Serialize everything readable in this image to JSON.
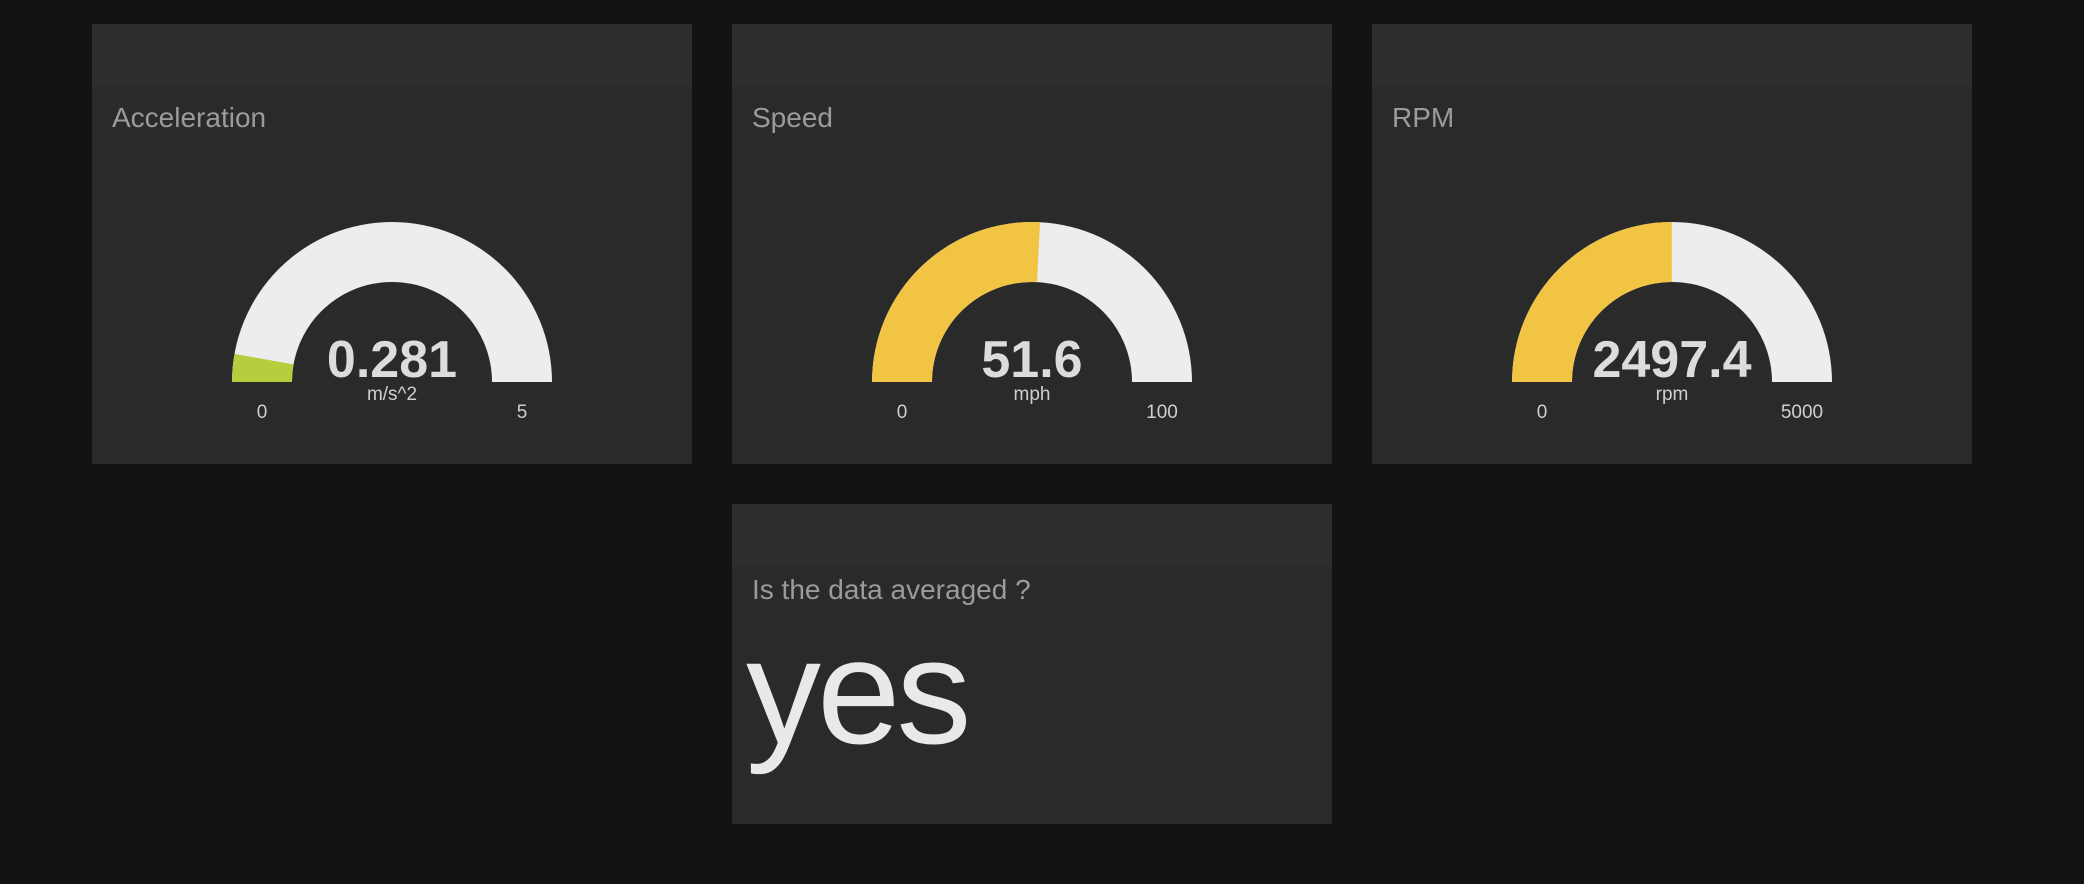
{
  "panes": [
    {
      "title": "Acceleration",
      "value": 0.281,
      "value_text": "0.281",
      "unit": "m/s^2",
      "min": 0,
      "max": 5,
      "min_text": "0",
      "max_text": "5",
      "fill_color": "#b8cd3e"
    },
    {
      "title": "Speed",
      "value": 51.6,
      "value_text": "51.6",
      "unit": "mph",
      "min": 0,
      "max": 100,
      "min_text": "0",
      "max_text": "100",
      "fill_color": "#f1c444"
    },
    {
      "title": "RPM",
      "value": 2497.4,
      "value_text": "2497.4",
      "unit": "rpm",
      "min": 0,
      "max": 5000,
      "min_text": "0",
      "max_text": "5000",
      "fill_color": "#f1c444"
    }
  ],
  "text_pane": {
    "title": "Is the data averaged ?",
    "value": "yes"
  },
  "colors": {
    "page_bg": "#111214",
    "pane_bg": "#2a2a2a",
    "gauge_track": "#ededed"
  }
}
